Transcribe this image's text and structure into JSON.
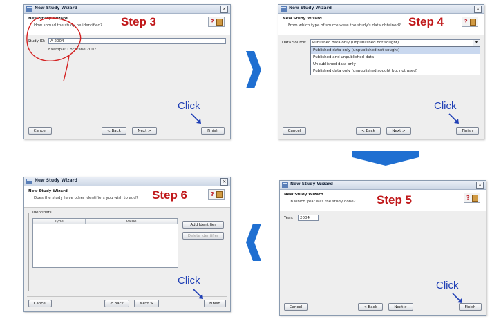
{
  "window_title": "New Study Wizard",
  "buttons": {
    "cancel": "Cancel",
    "back": "< Back",
    "next": "Next >",
    "finish": "Finish"
  },
  "click_label": "Click",
  "step3": {
    "step_label": "Step 3",
    "heading": "New Study Wizard",
    "question": "How should the study be identified?",
    "field_label": "Study ID:",
    "field_value": "A 2004",
    "example": "Example: Cochrane 2007"
  },
  "step4": {
    "step_label": "Step 4",
    "heading": "New Study Wizard",
    "question": "From which type of source were the study's data obtained?",
    "field_label": "Data Source:",
    "selected": "Published data only (unpublished not sought)",
    "options": [
      "Published data only (unpublished not sought)",
      "Published and unpublished data",
      "Unpublished data only",
      "Published data only (unpublished sought but not used)"
    ]
  },
  "step5": {
    "step_label": "Step 5",
    "heading": "New Study Wizard",
    "question": "In which year was the study done?",
    "field_label": "Year:",
    "field_value": "2004"
  },
  "step6": {
    "step_label": "Step 6",
    "heading": "New Study Wizard",
    "question": "Does the study have other identifiers you wish to add?",
    "group_title": "Identifiers",
    "col_type": "Type",
    "col_value": "Value",
    "add_button": "Add Identifier",
    "delete_button": "Delete Identifier"
  },
  "colors": {
    "step_red": "#c0181a",
    "click_blue": "#1f3fb5",
    "arrow_blue": "#1f6fd1"
  }
}
